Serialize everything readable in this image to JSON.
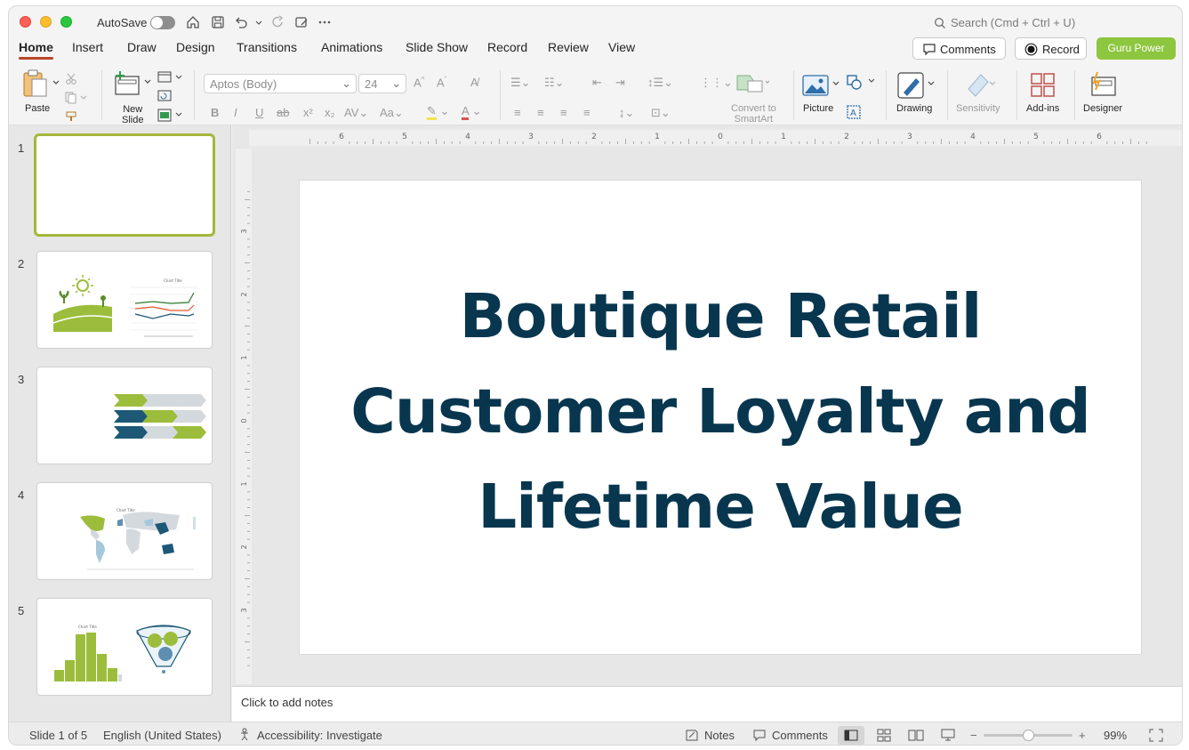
{
  "titlebar": {
    "autosave_label": "AutoSave",
    "search_placeholder": "Search (Cmd + Ctrl + U)"
  },
  "tabs": [
    {
      "label": "Home",
      "active": true
    },
    {
      "label": "Insert"
    },
    {
      "label": "Draw"
    },
    {
      "label": "Design"
    },
    {
      "label": "Transitions"
    },
    {
      "label": "Animations"
    },
    {
      "label": "Slide Show"
    },
    {
      "label": "Record"
    },
    {
      "label": "Review"
    },
    {
      "label": "View"
    }
  ],
  "header_buttons": {
    "comments": "Comments",
    "record": "Record",
    "guru": "Guru Power"
  },
  "ribbon": {
    "paste": "Paste",
    "new_slide_1": "New",
    "new_slide_2": "Slide",
    "font_name": "Aptos (Body)",
    "font_size": "24",
    "convert_1": "Convert to",
    "convert_2": "SmartArt",
    "picture": "Picture",
    "drawing": "Drawing",
    "sensitivity": "Sensitivity",
    "addins": "Add-ins",
    "designer": "Designer"
  },
  "thumbnails": [
    {
      "number": "1"
    },
    {
      "number": "2",
      "chart_title": "Chart Title"
    },
    {
      "number": "3"
    },
    {
      "number": "4",
      "chart_title": "Chart Title"
    },
    {
      "number": "5",
      "chart_title": "Chart Title"
    }
  ],
  "ruler": {
    "h_ticks": [
      "6",
      "5",
      "4",
      "3",
      "2",
      "1",
      "0",
      "1",
      "2",
      "3",
      "4",
      "5",
      "6"
    ],
    "v_ticks": [
      "3",
      "2",
      "1",
      "0",
      "1",
      "2",
      "3"
    ]
  },
  "slide": {
    "title_line1": "Boutique Retail",
    "title_line2": "Customer Loyalty and",
    "title_line3": "Lifetime Value"
  },
  "notes": {
    "placeholder": "Click to add notes"
  },
  "status": {
    "slide_info": "Slide 1 of 5",
    "language": "English (United States)",
    "accessibility": "Accessibility: Investigate",
    "notes": "Notes",
    "comments": "Comments",
    "zoom": "99%",
    "zoom_level": 0.5
  },
  "colors": {
    "accent_tab": "#b7472a",
    "title_text": "#08364f",
    "thumb_selected": "#a4b73c",
    "guru": "#8dc63f",
    "lime": "#9cbd3c",
    "navy": "#1d5877"
  }
}
